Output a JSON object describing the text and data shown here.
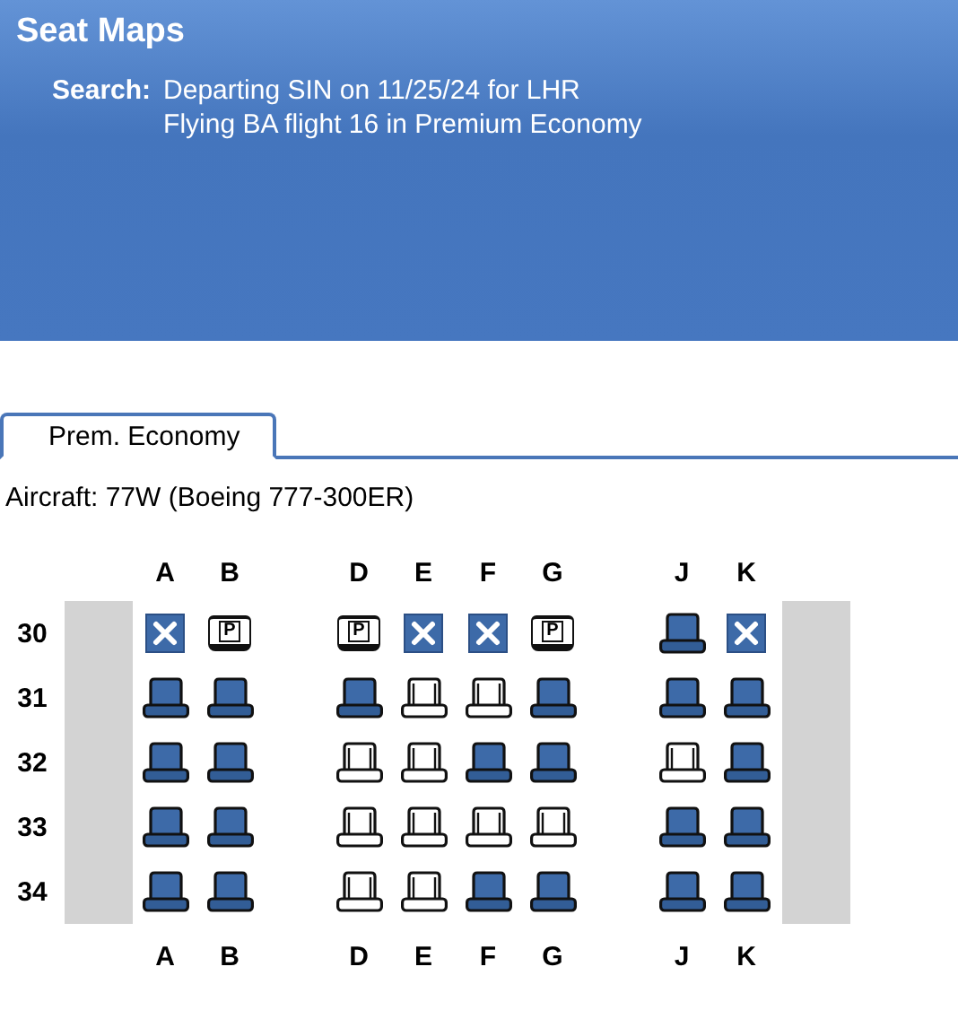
{
  "header": {
    "title": "Seat Maps",
    "search_label": "Search:",
    "search_lines": [
      "Departing SIN on 11/25/24 for LHR",
      "Flying BA flight 16 in Premium Economy"
    ]
  },
  "tabs": [
    {
      "label": "Prem. Economy",
      "selected": true
    }
  ],
  "aircraft": "Aircraft: 77W (Boeing 777-300ER)",
  "columns_top": [
    [
      "A",
      "B"
    ],
    [
      "D",
      "E",
      "F",
      "G"
    ],
    [
      "J",
      "K"
    ]
  ],
  "columns_bottom": [
    [
      "A",
      "B"
    ],
    [
      "D",
      "E",
      "F",
      "G"
    ],
    [
      "J",
      "K"
    ]
  ],
  "rows": [
    {
      "number": "30",
      "groups": [
        [
          {
            "kind": "blocked"
          },
          {
            "kind": "preferred",
            "label": "P"
          }
        ],
        [
          {
            "kind": "preferred",
            "label": "P"
          },
          {
            "kind": "blocked"
          },
          {
            "kind": "blocked"
          },
          {
            "kind": "preferred",
            "label": "P"
          }
        ],
        [
          {
            "kind": "occupied"
          },
          {
            "kind": "blocked"
          }
        ]
      ]
    },
    {
      "number": "31",
      "groups": [
        [
          {
            "kind": "occupied"
          },
          {
            "kind": "occupied"
          }
        ],
        [
          {
            "kind": "occupied"
          },
          {
            "kind": "available"
          },
          {
            "kind": "available"
          },
          {
            "kind": "occupied"
          }
        ],
        [
          {
            "kind": "occupied"
          },
          {
            "kind": "occupied"
          }
        ]
      ]
    },
    {
      "number": "32",
      "groups": [
        [
          {
            "kind": "occupied"
          },
          {
            "kind": "occupied"
          }
        ],
        [
          {
            "kind": "available"
          },
          {
            "kind": "available"
          },
          {
            "kind": "occupied"
          },
          {
            "kind": "occupied"
          }
        ],
        [
          {
            "kind": "available"
          },
          {
            "kind": "occupied"
          }
        ]
      ]
    },
    {
      "number": "33",
      "groups": [
        [
          {
            "kind": "occupied"
          },
          {
            "kind": "occupied"
          }
        ],
        [
          {
            "kind": "available"
          },
          {
            "kind": "available"
          },
          {
            "kind": "available"
          },
          {
            "kind": "available"
          }
        ],
        [
          {
            "kind": "occupied"
          },
          {
            "kind": "occupied"
          }
        ]
      ]
    },
    {
      "number": "34",
      "groups": [
        [
          {
            "kind": "occupied"
          },
          {
            "kind": "occupied"
          }
        ],
        [
          {
            "kind": "available"
          },
          {
            "kind": "available"
          },
          {
            "kind": "occupied"
          },
          {
            "kind": "occupied"
          }
        ],
        [
          {
            "kind": "occupied"
          },
          {
            "kind": "occupied"
          }
        ]
      ]
    }
  ]
}
